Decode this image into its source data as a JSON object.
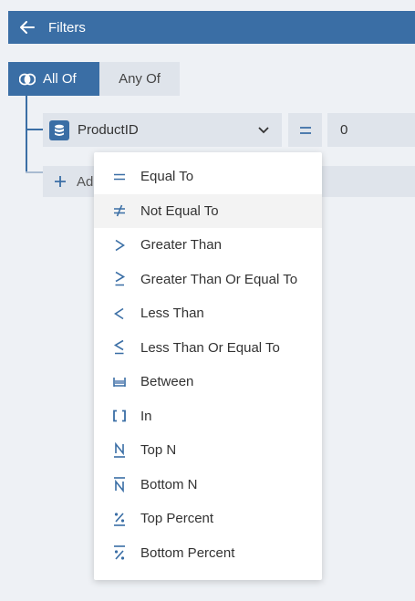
{
  "header": {
    "title": "Filters",
    "back_icon": "arrow-left-icon"
  },
  "group": {
    "all_label": "All Of",
    "any_label": "Any Of"
  },
  "condition": {
    "field": "ProductID",
    "operator_symbol": "=",
    "value": "0"
  },
  "add": {
    "label": "Ad"
  },
  "operators": [
    {
      "label": "Equal To",
      "icon": "equal-icon"
    },
    {
      "label": "Not Equal To",
      "icon": "not-equal-icon"
    },
    {
      "label": "Greater Than",
      "icon": "greater-than-icon"
    },
    {
      "label": "Greater Than Or Equal To",
      "icon": "greater-equal-icon"
    },
    {
      "label": "Less Than",
      "icon": "less-than-icon"
    },
    {
      "label": "Less Than Or Equal To",
      "icon": "less-equal-icon"
    },
    {
      "label": "Between",
      "icon": "between-icon"
    },
    {
      "label": "In",
      "icon": "in-icon"
    },
    {
      "label": "Top N",
      "icon": "top-n-icon"
    },
    {
      "label": "Bottom N",
      "icon": "bottom-n-icon"
    },
    {
      "label": "Top Percent",
      "icon": "top-percent-icon"
    },
    {
      "label": "Bottom Percent",
      "icon": "bottom-percent-icon"
    }
  ],
  "colors": {
    "accent": "#3a6ea5",
    "panel": "#dfe4eb",
    "background": "#eef1f5"
  }
}
